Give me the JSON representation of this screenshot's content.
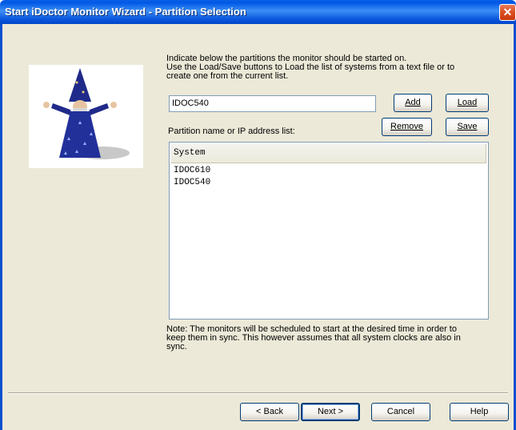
{
  "window": {
    "title": "Start iDoctor Monitor Wizard - Partition Selection",
    "close_glyph": "✕"
  },
  "instructions": {
    "line1": "Indicate below the partitions the monitor should be started on.",
    "line2": "Use the Load/Save buttons to Load the list of systems from a text file or to",
    "line3": "create one from the current list."
  },
  "input": {
    "value": "IDOC540"
  },
  "buttons": {
    "add": "Add",
    "load": "Load",
    "remove": "Remove",
    "save": "Save",
    "back": "< Back",
    "next": "Next >",
    "cancel": "Cancel",
    "help": "Help"
  },
  "list": {
    "label": "Partition name or IP address list:",
    "header": "System",
    "items": [
      "IDOC610",
      "IDOC540"
    ]
  },
  "note": {
    "line1": "Note: The monitors will be scheduled to start at the desired time in order to",
    "line2": "keep them in sync.  This however assumes that all system clocks are also in",
    "line3": "sync."
  }
}
